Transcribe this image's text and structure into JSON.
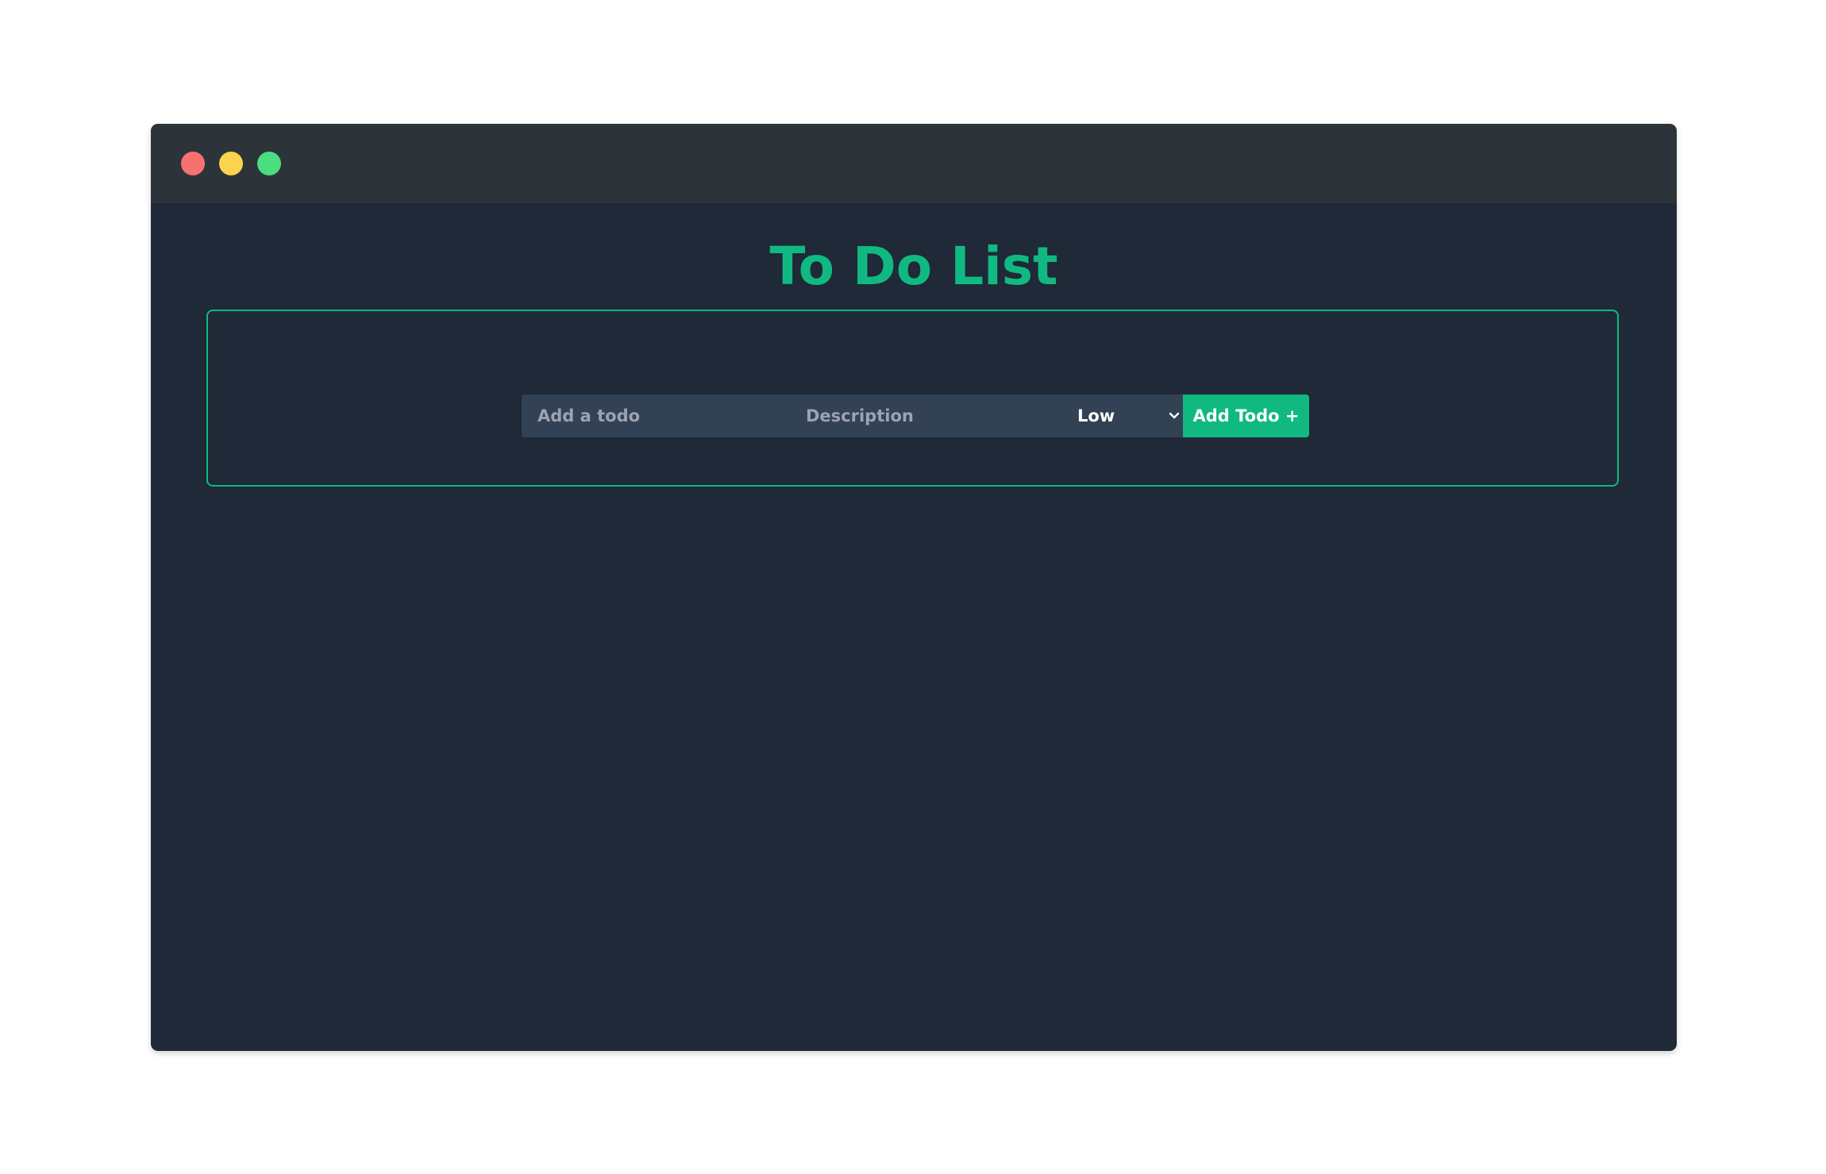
{
  "window": {
    "controls": [
      {
        "name": "close",
        "color": "#f87171"
      },
      {
        "name": "minimize",
        "color": "#fcd34d"
      },
      {
        "name": "maximize",
        "color": "#4ade80"
      }
    ]
  },
  "header": {
    "title": "To Do List"
  },
  "form": {
    "todo_placeholder": "Add a todo",
    "description_placeholder": "Description",
    "priority_selected": "Low",
    "add_button_label": "Add Todo +"
  },
  "colors": {
    "accent": "#10b981",
    "background": "#1f2937",
    "titlebar": "#2d3439",
    "input_background": "#334155"
  }
}
